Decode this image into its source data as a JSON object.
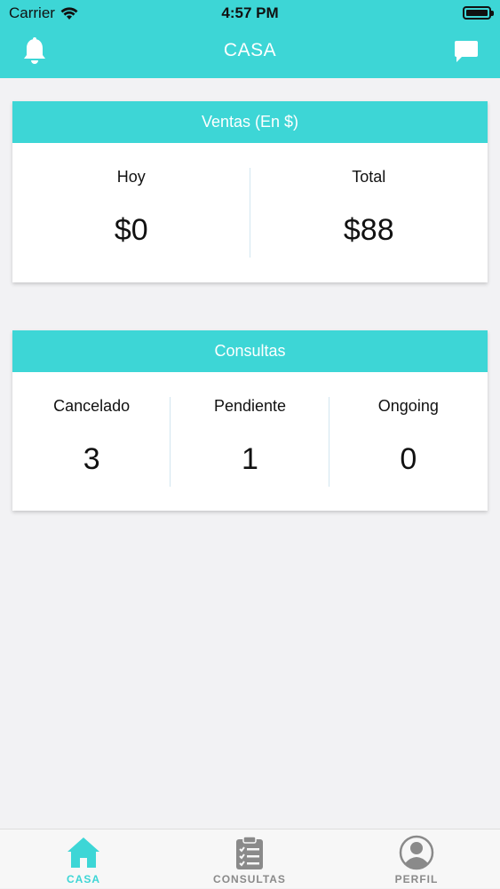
{
  "status": {
    "carrier": "Carrier",
    "time": "4:57 PM"
  },
  "header": {
    "title": "CASA"
  },
  "ventas": {
    "title": "Ventas (En $)",
    "items": [
      {
        "label": "Hoy",
        "value": "$0"
      },
      {
        "label": "Total",
        "value": "$88"
      }
    ]
  },
  "consultas": {
    "title": "Consultas",
    "items": [
      {
        "label": "Cancelado",
        "value": "3"
      },
      {
        "label": "Pendiente",
        "value": "1"
      },
      {
        "label": "Ongoing",
        "value": "0"
      }
    ]
  },
  "tabs": [
    {
      "label": "CASA",
      "icon": "home-icon",
      "active": true
    },
    {
      "label": "CONSULTAS",
      "icon": "clipboard-icon",
      "active": false
    },
    {
      "label": "PERFIL",
      "icon": "profile-icon",
      "active": false
    }
  ],
  "colors": {
    "accent": "#3dd6d6",
    "inactive": "#8a8a8a"
  }
}
